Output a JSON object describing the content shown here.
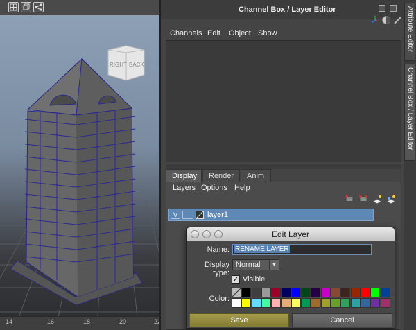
{
  "viewport": {
    "viewcube": {
      "right_label": "RIGHT",
      "back_label": "BACK"
    },
    "timeline_numbers": [
      "14",
      "16",
      "18",
      "20",
      "22"
    ]
  },
  "panel": {
    "title": "Channel Box / Layer Editor",
    "channel_menu": [
      "Channels",
      "Edit",
      "Object",
      "Show"
    ],
    "tabs": [
      "Display",
      "Render",
      "Anim"
    ],
    "active_tab": "Display",
    "layer_menu": [
      "Layers",
      "Options",
      "Help"
    ],
    "layer": {
      "visible_flag": "V",
      "name": "layer1"
    }
  },
  "side_tabs": [
    "Attribute Editor",
    "Channel Box / Layer Editor"
  ],
  "dialog": {
    "title": "Edit Layer",
    "name_label": "Name:",
    "name_value": "RENAME LAYER",
    "display_type_label": "Display type:",
    "display_type_value": "Normal",
    "visible_label": "Visible",
    "visible_checked": true,
    "color_label": "Color:",
    "save_label": "Save",
    "cancel_label": "Cancel",
    "palette_row1": [
      "none",
      "#000000",
      "#3f3f3f",
      "#999999",
      "#9b0028",
      "#000060",
      "#0000ff",
      "#004619",
      "#260043",
      "#c800c8",
      "#8a4833",
      "#3f231f",
      "#992600",
      "#ff0000",
      "#00ff00",
      "#004199"
    ],
    "palette_row2": [
      "#ffffff",
      "#ffff00",
      "#64dcff",
      "#43ffa3",
      "#ffb0b0",
      "#e4ac79",
      "#ffff63",
      "#009954",
      "#a1692a",
      "#9fa12a",
      "#68a12a",
      "#30a15d",
      "#30a1a1",
      "#3067a1",
      "#6f30a1",
      "#a1306a"
    ]
  },
  "colors": {
    "accent_save": "#958b3e",
    "layer_highlight": "#5e88b6"
  }
}
